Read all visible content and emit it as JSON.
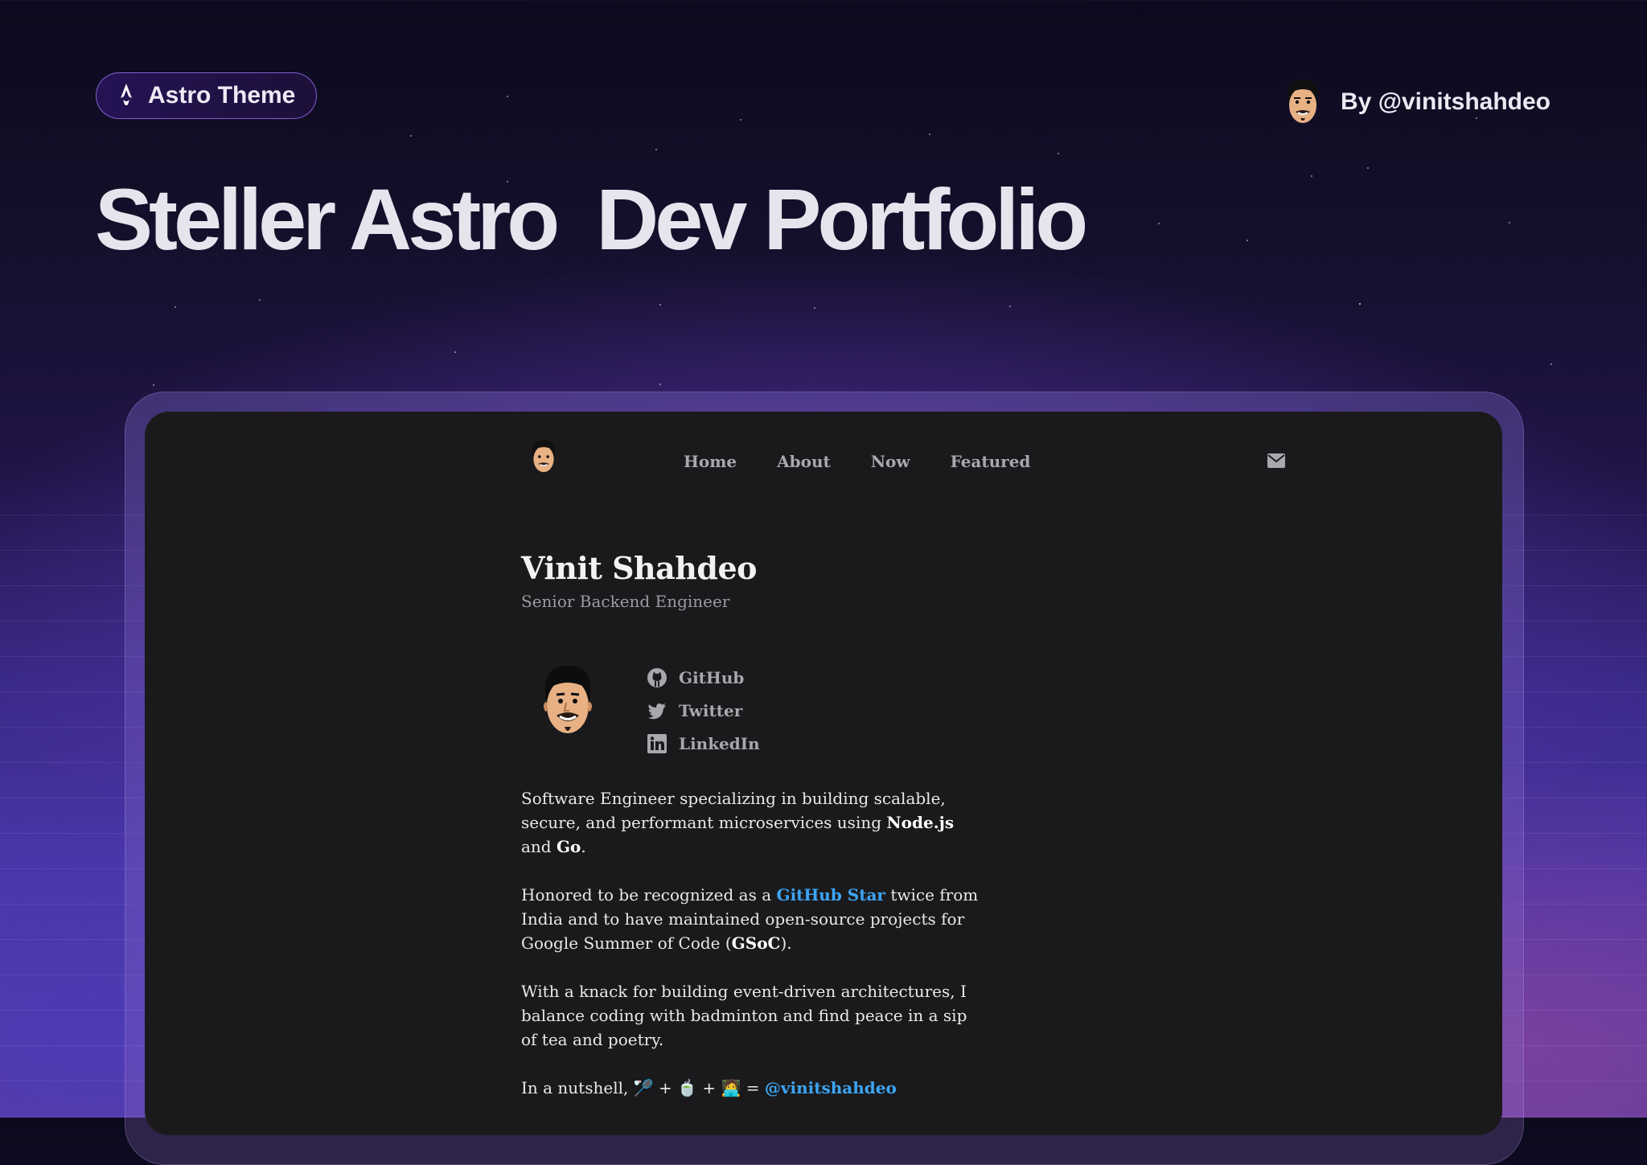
{
  "badge": {
    "icon": "astro-logo-icon",
    "label": "Astro Theme"
  },
  "author": {
    "label": "By @vinitshahdeo",
    "avatar": "avatar-icon"
  },
  "hero": {
    "title": "Steller Astro  Dev Portfolio"
  },
  "site": {
    "nav": {
      "links": [
        "Home",
        "About",
        "Now",
        "Featured"
      ],
      "mail_icon": "mail-icon"
    },
    "name": "Vinit Shahdeo",
    "role": "Senior Backend Engineer",
    "socials": [
      {
        "label": "GitHub",
        "icon": "github-icon"
      },
      {
        "label": "Twitter",
        "icon": "twitter-icon"
      },
      {
        "label": "LinkedIn",
        "icon": "linkedin-icon"
      }
    ],
    "bio": {
      "p1_a": "Software Engineer specializing in building scalable, secure, and performant microservices using ",
      "p1_b": "Node.js",
      "p1_c": " and ",
      "p1_d": "Go",
      "p1_e": ".",
      "p2_a": "Honored to be recognized as a ",
      "p2_link": "GitHub Star",
      "p2_b": " twice from India and to have maintained open-source projects for Google Summer of Code (",
      "p2_c": "GSoC",
      "p2_d": ").",
      "p3": "With a knack for building event-driven architectures, I balance coding with badminton and find peace in a sip of tea and poetry.",
      "p4_a": "In a nutshell, ",
      "p4_emoji1": "🏸",
      "p4_plus1": " + ",
      "p4_emoji2": "🍵",
      "p4_plus2": " + ",
      "p4_emoji3": "🧑‍💻",
      "p4_eq": " = ",
      "p4_link": "@vinitshahdeo"
    }
  },
  "colors": {
    "accent_link": "#3da5f5",
    "card_bg": "#1a1a1c",
    "badge_border": "#a878ff"
  }
}
